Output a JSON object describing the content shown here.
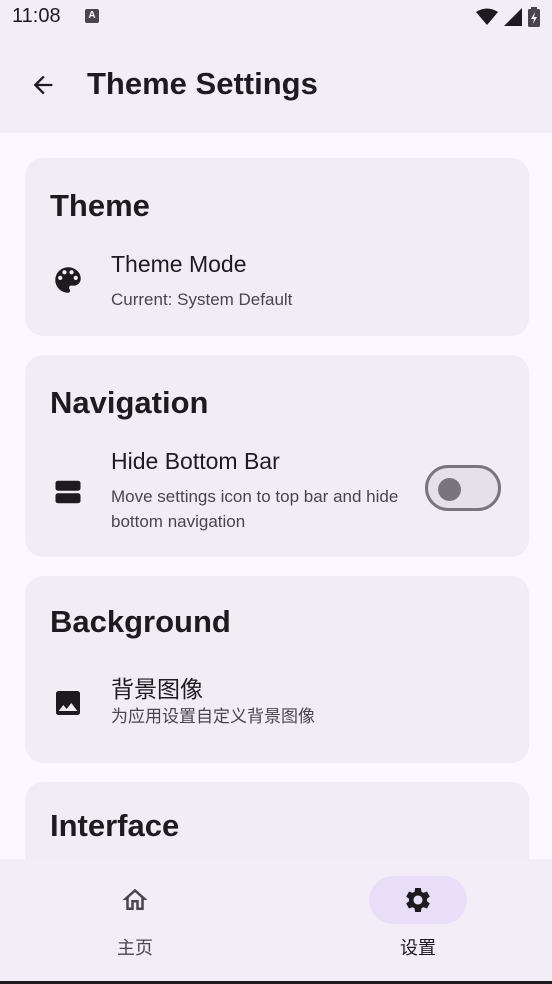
{
  "status_bar": {
    "time": "11:08",
    "a_badge": "A",
    "icons": [
      "wifi-icon",
      "signal-icon",
      "battery-icon"
    ]
  },
  "app_bar": {
    "title": "Theme Settings",
    "back_icon": "arrow-back-icon"
  },
  "sections": [
    {
      "title": "Theme",
      "items": [
        {
          "icon": "palette-icon",
          "label": "Theme Mode",
          "description": "Current: System Default"
        }
      ]
    },
    {
      "title": "Navigation",
      "items": [
        {
          "icon": "view-agenda-icon",
          "label": "Hide Bottom Bar",
          "description": "Move settings icon to top bar and hide bottom navigation",
          "toggle_on": false
        }
      ]
    },
    {
      "title": "Background",
      "items": [
        {
          "icon": "image-icon",
          "label": "背景图像",
          "description": "为应用设置自定义背景图像"
        }
      ]
    },
    {
      "title": "Interface",
      "items": []
    }
  ],
  "bottom_nav": {
    "items": [
      {
        "label": "主页",
        "icon": "home-icon",
        "active": false
      },
      {
        "label": "设置",
        "icon": "settings-icon",
        "active": true
      }
    ]
  },
  "colors": {
    "background": "#fdf7ff",
    "surface": "#f3edf7",
    "card": "#f2ecf4",
    "indicator": "#e8def8",
    "on_surface": "#1d1b20",
    "on_surface_variant": "#49454f",
    "outline": "#79747e"
  }
}
